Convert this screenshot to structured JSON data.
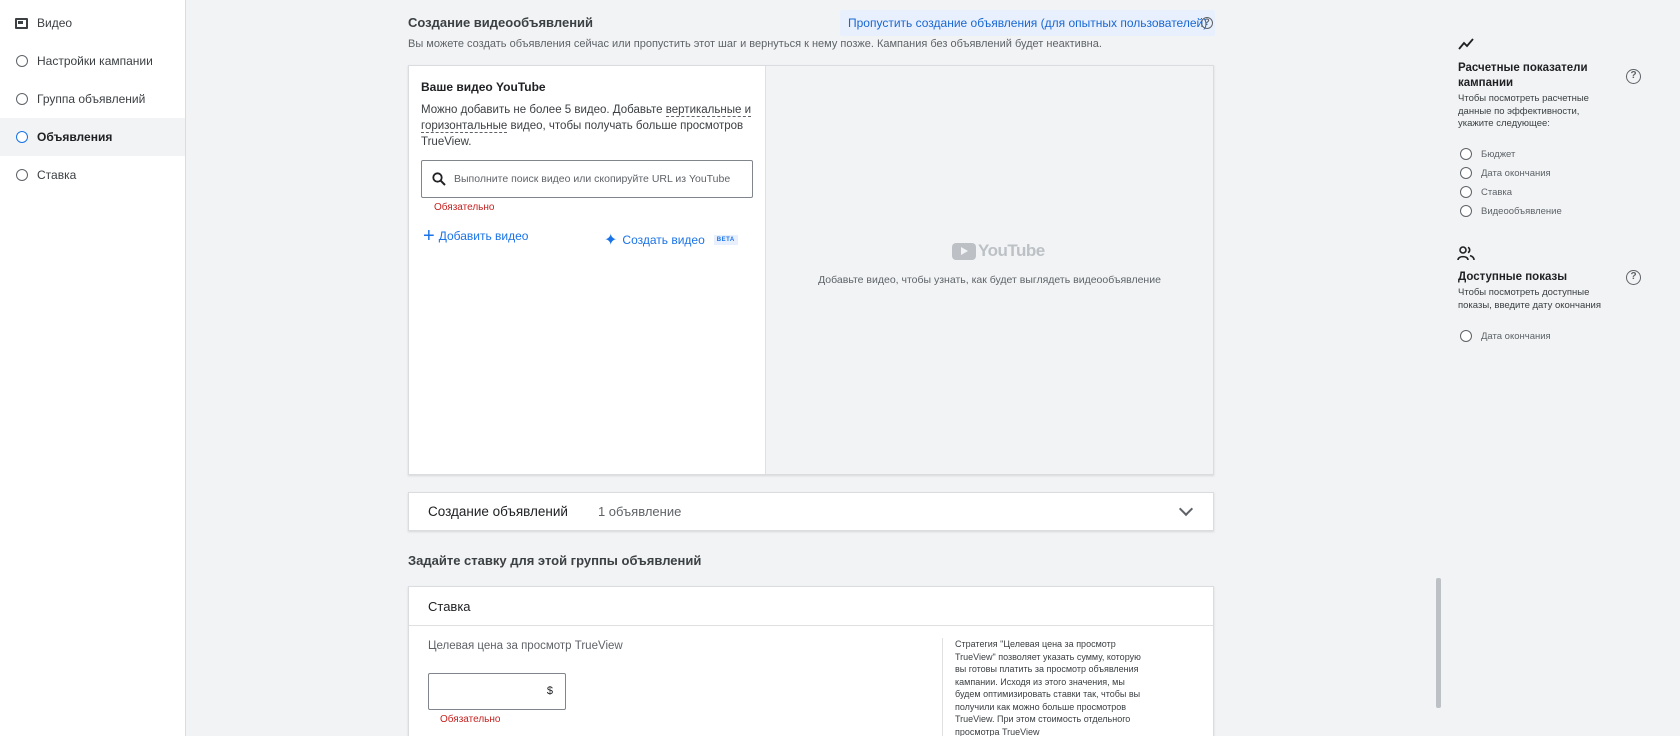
{
  "sidebar": {
    "items": [
      {
        "label": "Видео",
        "icon": "video-icon",
        "active": false
      },
      {
        "label": "Настройки кампании",
        "icon": "radio-circle-icon",
        "active": false
      },
      {
        "label": "Группа объявлений",
        "icon": "radio-circle-icon",
        "active": false
      },
      {
        "label": "Объявления",
        "icon": "radio-circle-icon",
        "active": true
      },
      {
        "label": "Ставка",
        "icon": "radio-circle-icon",
        "active": false
      }
    ]
  },
  "main": {
    "title": "Создание видеообъявлений",
    "skip_link": "Пропустить создание объявления (для опытных пользователей)",
    "help_icon": "?",
    "description": "Вы можете создать объявления сейчас или пропустить этот шаг и вернуться к нему позже. Кампания без объявлений будет неактивна.",
    "video_card": {
      "title": "Ваше видео YouTube",
      "desc_part1": "Можно добавить не более 5 видео. Добавьте ",
      "desc_link1": "вертикальные и горизонтальные",
      "desc_part2": " видео, чтобы получать больше просмотров TrueView.",
      "search_placeholder": "Выполните поиск видео или скопируйте URL из YouTube",
      "required": "Обязательно",
      "add_video": "Добавить видео",
      "create_video": "Создать видео",
      "beta_badge": "BETA",
      "youtube_logo_text": "YouTube",
      "preview_hint": "Добавьте видео, чтобы узнать, как будет выглядеть видеообъявление"
    },
    "ads_section": {
      "title": "Создание объявлений",
      "count": "1 объявление"
    },
    "bid_heading": "Задайте ставку для этой группы объявлений",
    "bid_card": {
      "title": "Ставка",
      "label": "Целевая цена за просмотр TrueView",
      "currency": "$",
      "required": "Обязательно",
      "strategy_text": "Стратегия \"Целевая цена за просмотр TrueView\" позволяет указать сумму, которую вы готовы платить за просмотр объявления кампании. Исходя из этого значения, мы будем оптимизировать ставки так, чтобы вы получили как можно больше просмотров TrueView. При этом стоимость отдельного просмотра TrueView"
    }
  },
  "right_panel": {
    "estimates": {
      "title": "Расчетные показатели кампании",
      "description": "Чтобы посмотреть расчетные данные по эффективности, укажите следующее:",
      "items": [
        "Бюджет",
        "Дата окончания",
        "Ставка",
        "Видеообъявление"
      ]
    },
    "reach": {
      "title": "Доступные показы",
      "description": "Чтобы посмотреть доступные показы, введите дату окончания",
      "items": [
        "Дата окончания"
      ]
    }
  },
  "colors": {
    "accent": "#1a73e8",
    "error": "#c5221f",
    "background": "#f1f3f4"
  }
}
